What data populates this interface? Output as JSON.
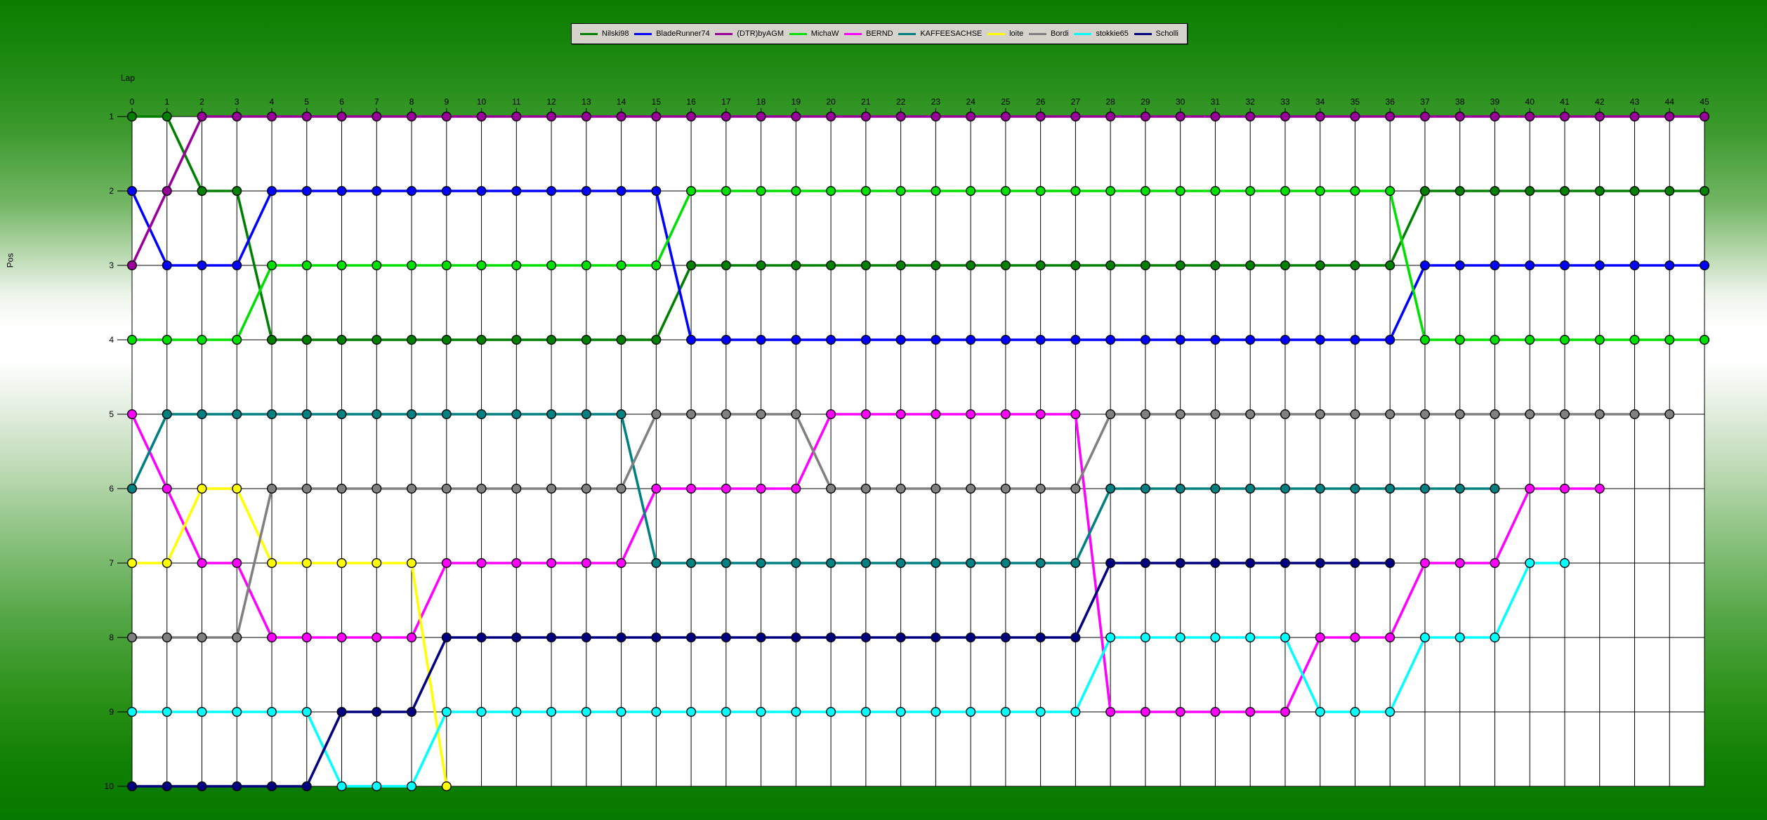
{
  "colors": {
    "plot_bg": "#ffffff",
    "grid": "#000000",
    "legend_bg": "#d6d3cd",
    "bg_top_green": "#0a7c00",
    "bg_mid_white": "#ffffff",
    "bg_bottom_green": "#067a00"
  },
  "axes": {
    "x_title": "Lap",
    "y_title": "Pos"
  },
  "chart_data": {
    "type": "line",
    "title": "",
    "xlabel": "Lap",
    "ylabel": "Pos",
    "x_range": [
      0,
      45
    ],
    "y_range": [
      1,
      10
    ],
    "y_inverted": true,
    "grid": true,
    "marker": "circle",
    "legend_position": "top-center",
    "x_ticks": [
      0,
      1,
      2,
      3,
      4,
      5,
      6,
      7,
      8,
      9,
      10,
      11,
      12,
      13,
      14,
      15,
      16,
      17,
      18,
      19,
      20,
      21,
      22,
      23,
      24,
      25,
      26,
      27,
      28,
      29,
      30,
      31,
      32,
      33,
      34,
      35,
      36,
      37,
      38,
      39,
      40,
      41,
      42,
      43,
      44,
      45
    ],
    "y_ticks": [
      1,
      2,
      3,
      4,
      5,
      6,
      7,
      8,
      9,
      10
    ],
    "series": [
      {
        "name": "Nilski98",
        "color": "#008000",
        "start_lap": 0,
        "positions": [
          1,
          1,
          2,
          2,
          4,
          4,
          4,
          4,
          4,
          4,
          4,
          4,
          4,
          4,
          4,
          4,
          3,
          3,
          3,
          3,
          3,
          3,
          3,
          3,
          3,
          3,
          3,
          3,
          3,
          3,
          3,
          3,
          3,
          3,
          3,
          3,
          3,
          2,
          2,
          2,
          2,
          2,
          2,
          2,
          2,
          2
        ]
      },
      {
        "name": "BladeRunner74",
        "color": "#0000ff",
        "start_lap": 0,
        "positions": [
          2,
          3,
          3,
          3,
          2,
          2,
          2,
          2,
          2,
          2,
          2,
          2,
          2,
          2,
          2,
          2,
          4,
          4,
          4,
          4,
          4,
          4,
          4,
          4,
          4,
          4,
          4,
          4,
          4,
          4,
          4,
          4,
          4,
          4,
          4,
          4,
          4,
          3,
          3,
          3,
          3,
          3,
          3,
          3,
          3,
          3
        ]
      },
      {
        "name": "(DTR)byAGM",
        "color": "#990099",
        "start_lap": 0,
        "positions": [
          3,
          2,
          1,
          1,
          1,
          1,
          1,
          1,
          1,
          1,
          1,
          1,
          1,
          1,
          1,
          1,
          1,
          1,
          1,
          1,
          1,
          1,
          1,
          1,
          1,
          1,
          1,
          1,
          1,
          1,
          1,
          1,
          1,
          1,
          1,
          1,
          1,
          1,
          1,
          1,
          1,
          1,
          1,
          1,
          1,
          1
        ]
      },
      {
        "name": "MichaW",
        "color": "#00e000",
        "start_lap": 0,
        "positions": [
          4,
          4,
          4,
          4,
          3,
          3,
          3,
          3,
          3,
          3,
          3,
          3,
          3,
          3,
          3,
          3,
          2,
          2,
          2,
          2,
          2,
          2,
          2,
          2,
          2,
          2,
          2,
          2,
          2,
          2,
          2,
          2,
          2,
          2,
          2,
          2,
          2,
          4,
          4,
          4,
          4,
          4,
          4,
          4,
          4,
          4
        ]
      },
      {
        "name": "BERND",
        "color": "#ff00ff",
        "start_lap": 0,
        "positions": [
          5,
          6,
          7,
          7,
          8,
          8,
          8,
          8,
          8,
          7,
          7,
          7,
          7,
          7,
          7,
          6,
          6,
          6,
          6,
          6,
          5,
          5,
          5,
          5,
          5,
          5,
          5,
          5,
          9,
          9,
          9,
          9,
          9,
          9,
          8,
          8,
          8,
          7,
          7,
          7,
          6,
          6,
          6
        ]
      },
      {
        "name": "KAFFEESACHSE",
        "color": "#008080",
        "start_lap": 0,
        "positions": [
          6,
          5,
          5,
          5,
          5,
          5,
          5,
          5,
          5,
          5,
          5,
          5,
          5,
          5,
          5,
          7,
          7,
          7,
          7,
          7,
          7,
          7,
          7,
          7,
          7,
          7,
          7,
          7,
          6,
          6,
          6,
          6,
          6,
          6,
          6,
          6,
          6,
          6,
          6,
          6
        ]
      },
      {
        "name": "loite",
        "color": "#ffff00",
        "start_lap": 0,
        "positions": [
          7,
          7,
          6,
          6,
          7,
          7,
          7,
          7,
          7,
          10
        ]
      },
      {
        "name": "Bordi",
        "color": "#808080",
        "start_lap": 0,
        "positions": [
          8,
          8,
          8,
          8,
          6,
          6,
          6,
          6,
          6,
          6,
          6,
          6,
          6,
          6,
          6,
          5,
          5,
          5,
          5,
          5,
          6,
          6,
          6,
          6,
          6,
          6,
          6,
          6,
          5,
          5,
          5,
          5,
          5,
          5,
          5,
          5,
          5,
          5,
          5,
          5,
          5,
          5,
          5,
          5,
          5
        ]
      },
      {
        "name": "stokkie65",
        "color": "#00ffff",
        "start_lap": 0,
        "positions": [
          9,
          9,
          9,
          9,
          9,
          9,
          10,
          10,
          10,
          9,
          9,
          9,
          9,
          9,
          9,
          9,
          9,
          9,
          9,
          9,
          9,
          9,
          9,
          9,
          9,
          9,
          9,
          9,
          8,
          8,
          8,
          8,
          8,
          8,
          9,
          9,
          9,
          8,
          8,
          8,
          7,
          7
        ]
      },
      {
        "name": "Scholli",
        "color": "#000080",
        "start_lap": 0,
        "positions": [
          10,
          10,
          10,
          10,
          10,
          10,
          9,
          9,
          9,
          8,
          8,
          8,
          8,
          8,
          8,
          8,
          8,
          8,
          8,
          8,
          8,
          8,
          8,
          8,
          8,
          8,
          8,
          8,
          7,
          7,
          7,
          7,
          7,
          7,
          7,
          7,
          7
        ]
      }
    ]
  }
}
